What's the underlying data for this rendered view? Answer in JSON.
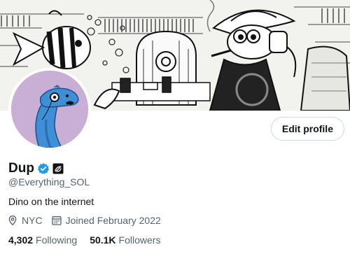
{
  "profile": {
    "display_name": "Dup",
    "handle": "@Everything_SOL",
    "bio": "Dino on the internet",
    "location": "NYC",
    "joined": "Joined February 2022"
  },
  "actions": {
    "edit_profile_label": "Edit profile"
  },
  "stats": {
    "following_count": "4,302",
    "following_label": "Following",
    "followers_count": "50.1K",
    "followers_label": "Followers"
  },
  "icons": {
    "verified": "verified-badge-icon",
    "affiliate": "affiliate-badge-icon",
    "location": "location-pin-icon",
    "calendar": "calendar-icon"
  },
  "colors": {
    "verified_blue": "#1d9bf0",
    "secondary_text": "#536471",
    "avatar_background": "#c9aed6",
    "dino_blue": "#3f8fd6"
  }
}
